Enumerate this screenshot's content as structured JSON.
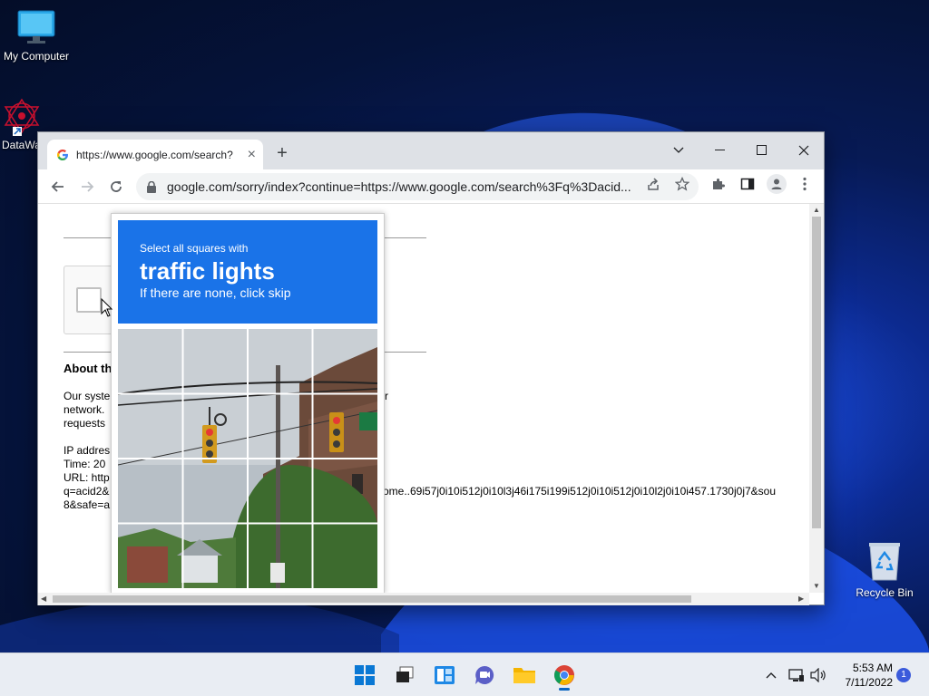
{
  "desktop": {
    "icons": [
      {
        "label": "My Computer"
      },
      {
        "label": "DataWa"
      },
      {
        "label": "Recycle Bin"
      }
    ]
  },
  "browser": {
    "tab_title": "https://www.google.com/search?",
    "address": "google.com/sorry/index?continue=https://www.google.com/search%3Fq%3Dacid...",
    "page": {
      "heading": "About th",
      "para1_l1": "Our syste",
      "para1_l1b": "r",
      "para1_l2": "network.",
      "para1_l3": "requests",
      "ip_label": "IP addres",
      "time_label": "Time: 20",
      "url_label": "URL: http",
      "url_line2": "q=acid2&",
      "url_line2b": "rome..69i57j0i10i512j0i10l3j46i175i199i512j0i10i512j0i10l2j0i10i457.1730j0j7&sou",
      "url_line3": "8&safe=a"
    },
    "captcha": {
      "line1": "Select all squares with",
      "line2": "traffic lights",
      "line3": "If there are none, click skip"
    }
  },
  "taskbar": {
    "time": "5:53 AM",
    "date": "7/11/2022",
    "notifications": "1"
  },
  "colors": {
    "captcha_blue": "#1a73e8",
    "taskbar_bg": "#e9edf3"
  }
}
